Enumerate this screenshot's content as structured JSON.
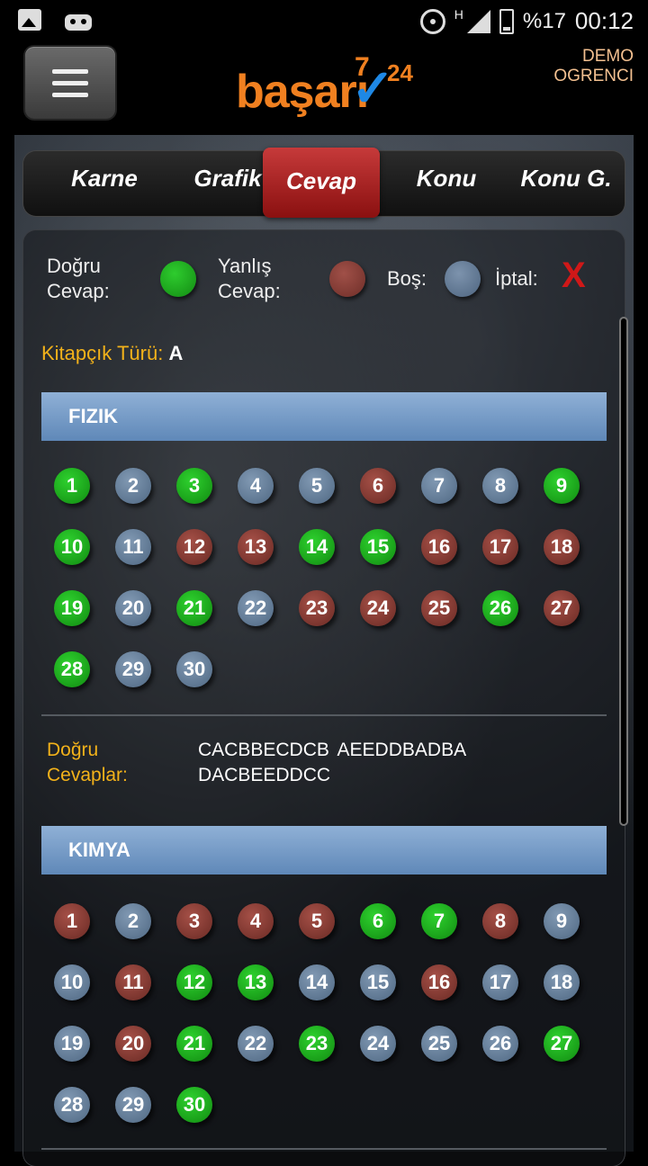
{
  "statusbar": {
    "battery": "%17",
    "time": "00:12",
    "network": "H"
  },
  "header": {
    "logo_main": "başarı",
    "logo_sup1": "7",
    "logo_sup2": "24",
    "user_line1": "DEMO",
    "user_line2": "OGRENCI"
  },
  "tabs": [
    {
      "label": "Karne"
    },
    {
      "label": "Grafik"
    },
    {
      "label": "Cevap",
      "active": true
    },
    {
      "label": "Konu"
    },
    {
      "label": "Konu G."
    }
  ],
  "legend": {
    "correct_line1": "Doğru",
    "correct_line2": "Cevap:",
    "wrong_line1": "Yanlış",
    "wrong_line2": "Cevap:",
    "empty": "Boş:",
    "cancel": "İptal:",
    "cancel_mark": "X"
  },
  "booklet": {
    "label": "Kitapçık Türü:",
    "value": "A"
  },
  "sections": [
    {
      "title": "FIZIK",
      "statuses": [
        "g",
        "b",
        "g",
        "b",
        "b",
        "r",
        "b",
        "b",
        "g",
        "g",
        "b",
        "r",
        "r",
        "g",
        "g",
        "r",
        "r",
        "r",
        "g",
        "b",
        "g",
        "b",
        "r",
        "r",
        "r",
        "g",
        "r",
        "g",
        "b",
        "b"
      ],
      "answers_label_1": "Doğru",
      "answers_label_2": "Cevaplar:",
      "answers_line1": "CACBBECDCB AEEDDBADBA",
      "answers_line2": "DACBEEDDCC"
    },
    {
      "title": "KIMYA",
      "statuses": [
        "r",
        "b",
        "r",
        "r",
        "r",
        "g",
        "g",
        "r",
        "b",
        "b",
        "r",
        "g",
        "g",
        "b",
        "b",
        "r",
        "b",
        "b",
        "b",
        "r",
        "g",
        "b",
        "g",
        "b",
        "b",
        "b",
        "g",
        "b",
        "b",
        "g"
      ]
    }
  ],
  "colors": {
    "correct": "#1ea51e",
    "wrong": "#8a3e36",
    "empty": "#6a819c",
    "accent": "#f3b21a",
    "tab_active": "#b02424"
  }
}
